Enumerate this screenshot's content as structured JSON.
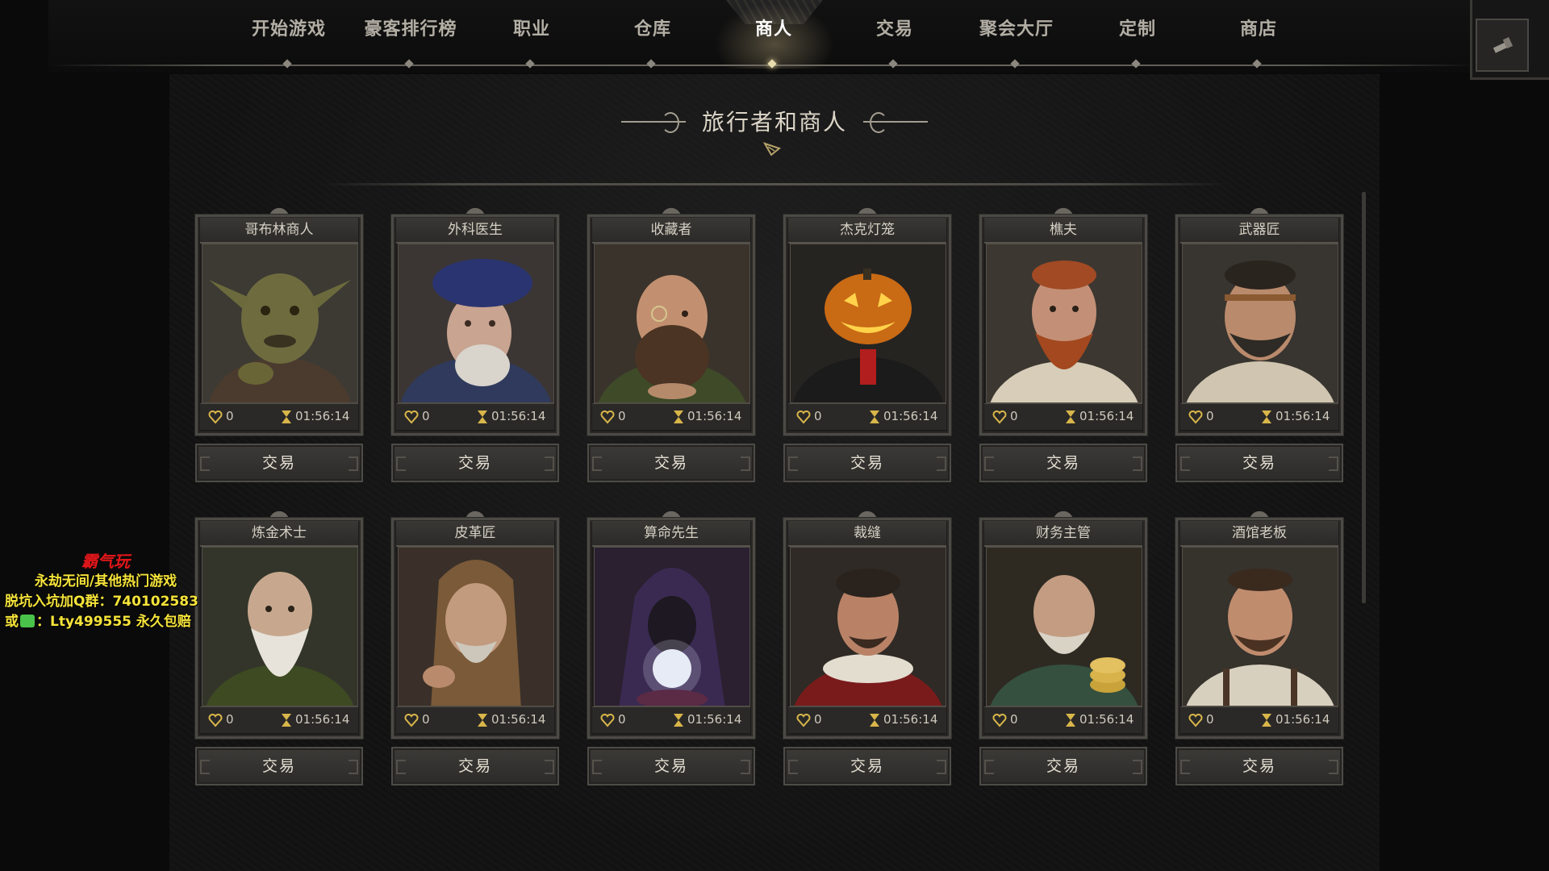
{
  "nav": {
    "items": [
      {
        "label": "开始游戏",
        "active": false
      },
      {
        "label": "豪客排行榜",
        "active": false
      },
      {
        "label": "职业",
        "active": false
      },
      {
        "label": "仓库",
        "active": false
      },
      {
        "label": "商人",
        "active": true
      },
      {
        "label": "交易",
        "active": false
      },
      {
        "label": "聚会大厅",
        "active": false
      },
      {
        "label": "定制",
        "active": false
      },
      {
        "label": "商店",
        "active": false
      }
    ],
    "corner_icon": "flashlight-icon"
  },
  "page": {
    "title": "旅行者和商人"
  },
  "merchants": [
    {
      "name": "哥布林商人",
      "affinity": "0",
      "timer": "01:56:14",
      "trade_label": "交易",
      "portrait": "goblin-portrait"
    },
    {
      "name": "外科医生",
      "affinity": "0",
      "timer": "01:56:14",
      "trade_label": "交易",
      "portrait": "surgeon-portrait"
    },
    {
      "name": "收藏者",
      "affinity": "0",
      "timer": "01:56:14",
      "trade_label": "交易",
      "portrait": "collector-portrait"
    },
    {
      "name": "杰克灯笼",
      "affinity": "0",
      "timer": "01:56:14",
      "trade_label": "交易",
      "portrait": "pumpkin-portrait"
    },
    {
      "name": "樵夫",
      "affinity": "0",
      "timer": "01:56:14",
      "trade_label": "交易",
      "portrait": "woodsman-portrait"
    },
    {
      "name": "武器匠",
      "affinity": "0",
      "timer": "01:56:14",
      "trade_label": "交易",
      "portrait": "weaponsmith-portrait"
    },
    {
      "name": "炼金术士",
      "affinity": "0",
      "timer": "01:56:14",
      "trade_label": "交易",
      "portrait": "alchemist-portrait"
    },
    {
      "name": "皮革匠",
      "affinity": "0",
      "timer": "01:56:14",
      "trade_label": "交易",
      "portrait": "leathersmith-portrait"
    },
    {
      "name": "算命先生",
      "affinity": "0",
      "timer": "01:56:14",
      "trade_label": "交易",
      "portrait": "fortune-teller-portrait"
    },
    {
      "name": "裁缝",
      "affinity": "0",
      "timer": "01:56:14",
      "trade_label": "交易",
      "portrait": "tailor-portrait"
    },
    {
      "name": "财务主管",
      "affinity": "0",
      "timer": "01:56:14",
      "trade_label": "交易",
      "portrait": "treasurer-portrait"
    },
    {
      "name": "酒馆老板",
      "affinity": "0",
      "timer": "01:56:14",
      "trade_label": "交易",
      "portrait": "tavern-keeper-portrait"
    }
  ],
  "overlay": {
    "logo": "霸气玩",
    "line1": "永劫无间/其他热门游戏",
    "line2": "脱坑入坑加Q群：740102583",
    "line3_prefix": "或",
    "line3_suffix": "：Lty499555 永久包赔",
    "colors": {
      "logo": "#e3161a",
      "text": "#f6e43a"
    }
  },
  "colors": {
    "background": "#0a0a0a",
    "frame": "#4c4a45",
    "accent_gold": "#d9b64a",
    "text": "#d6d0c4"
  }
}
